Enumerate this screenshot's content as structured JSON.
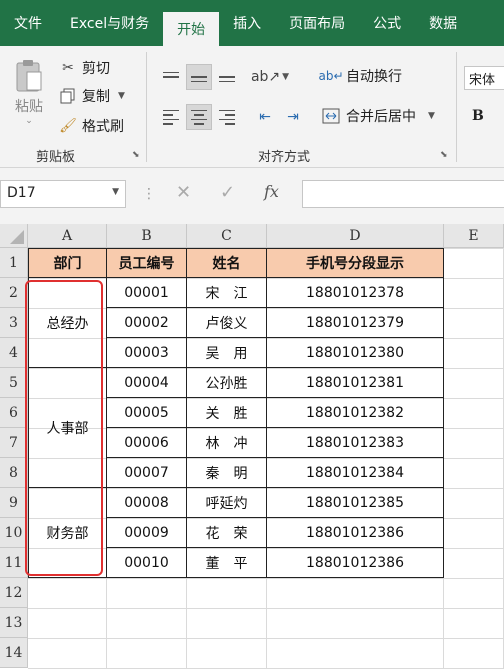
{
  "ribbon_tabs": [
    "文件",
    "Excel与财务",
    "开始",
    "插入",
    "页面布局",
    "公式",
    "数据"
  ],
  "clipboard": {
    "paste": "粘贴",
    "cut": "剪切",
    "copy": "复制",
    "format_painter": "格式刷",
    "group_label": "剪贴板"
  },
  "alignment": {
    "wrap_text": "自动换行",
    "merge_center": "合并后居中",
    "group_label": "对齐方式"
  },
  "font": {
    "name": "宋体",
    "bold": "B"
  },
  "formula_bar": {
    "name_box": "D17",
    "fx": "fx",
    "formula": ""
  },
  "columns": [
    "A",
    "B",
    "C",
    "D",
    "E"
  ],
  "rows": [
    "1",
    "2",
    "3",
    "4",
    "5",
    "6",
    "7",
    "8",
    "9",
    "10",
    "11",
    "12",
    "13",
    "14"
  ],
  "table": {
    "headers": [
      "部门",
      "员工编号",
      "姓名",
      "手机号分段显示"
    ],
    "departments": [
      "总经办",
      "人事部",
      "财务部"
    ],
    "rows": [
      {
        "id": "00001",
        "name": "宋　江",
        "phone": "18801012378"
      },
      {
        "id": "00002",
        "name": "卢俊义",
        "phone": "18801012379"
      },
      {
        "id": "00003",
        "name": "吴　用",
        "phone": "18801012380"
      },
      {
        "id": "00004",
        "name": "公孙胜",
        "phone": "18801012381"
      },
      {
        "id": "00005",
        "name": "关　胜",
        "phone": "18801012382"
      },
      {
        "id": "00006",
        "name": "林　冲",
        "phone": "18801012383"
      },
      {
        "id": "00007",
        "name": "秦　明",
        "phone": "18801012384"
      },
      {
        "id": "00008",
        "name": "呼延灼",
        "phone": "18801012385"
      },
      {
        "id": "00009",
        "name": "花　荣",
        "phone": "18801012386"
      },
      {
        "id": "00010",
        "name": "董　平",
        "phone": "18801012386"
      }
    ]
  },
  "colors": {
    "excel_green": "#217346",
    "header_fill": "#f8cbad",
    "highlight_red": "#e03030"
  }
}
